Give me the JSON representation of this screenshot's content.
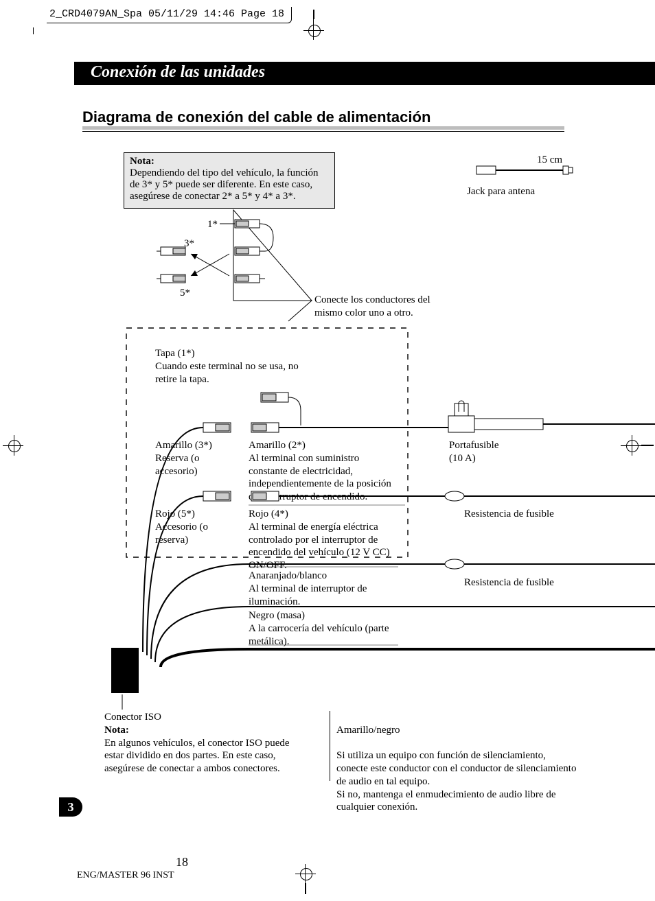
{
  "crop": {
    "header": "2_CRD4079AN_Spa  05/11/29 14:46  Page 18"
  },
  "section": {
    "title": "Conexión de las unidades",
    "subtitle": "Diagrama de conexión del cable de alimentación"
  },
  "note_box": {
    "label": "Nota:",
    "body": "Dependiendo del tipo del vehículo, la función de 3* y 5* puede ser diferente. En este caso, asegúrese de conectar 2* a 5* y 4* a 3*."
  },
  "refs": {
    "r1": "1*",
    "r2": "2*",
    "r3": "3*",
    "r4": "4*",
    "r5": "5*"
  },
  "antenna": {
    "length": "15 cm",
    "label": "Jack para antena"
  },
  "sameColor": "Conecte los conductores del mismo color uno a otro.",
  "tapa": {
    "line1": "Tapa (1*)",
    "line2": "Cuando este terminal no se usa, no retire la tapa."
  },
  "yellow3": {
    "line1": "Amarillo (3*)",
    "line2": "Reserva (o accesorio)"
  },
  "yellow2": {
    "line1": "Amarillo (2*)",
    "line2": "Al terminal con suministro constante de electricidad, independientemente de la posición del interruptor de encendido."
  },
  "fuse": {
    "line1": "Portafusible",
    "line2": "(10 A)"
  },
  "red5": {
    "line1": "Rojo (5*)",
    "line2": "Accesorio (o reserva)"
  },
  "red4": {
    "line1": "Rojo (4*)",
    "line2": "Al terminal de energía eléctrica controlado por el interruptor de encendido del vehículo (12 V CC) ON/OFF."
  },
  "resistor1": "Resistencia de fusible",
  "resistor2": "Resistencia de fusible",
  "orange": {
    "title": "Anaranjado/blanco",
    "body": "Al terminal de interruptor de iluminación."
  },
  "black": {
    "title": "Negro (masa)",
    "body": "A la carrocería del vehículo (parte metálica)."
  },
  "iso": {
    "title": "Conector ISO",
    "note_label": "Nota:",
    "note_body": "En algunos vehículos, el conector ISO puede estar dividido en dos partes. En este caso, asegúrese de conectar a ambos conectores."
  },
  "yellowBlack": {
    "title": "Amarillo/negro",
    "body": "Si utiliza un equipo con función de silenciamiento, conecte este conductor con el conductor de silenciamiento de audio en tal equipo.\nSi no, mantenga el enmudecimiento de audio libre de cualquier conexión."
  },
  "page": {
    "tab": "3",
    "number": "18",
    "footer": "ENG/MASTER 96 INST"
  }
}
